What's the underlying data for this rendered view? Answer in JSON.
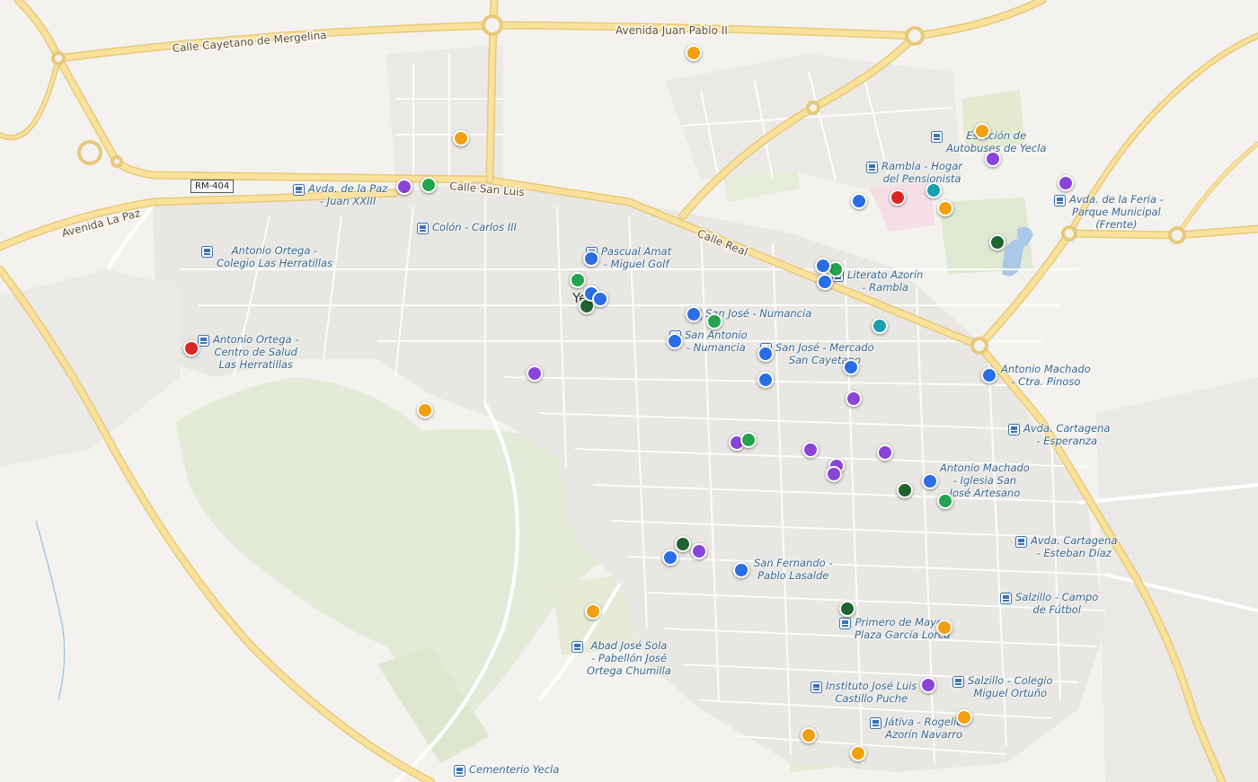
{
  "map": {
    "roads": [
      {
        "name": "Calle Cayetano de Mergelina"
      },
      {
        "name": "Avenida Juan Pablo II"
      },
      {
        "name": "Avenida La Paz"
      },
      {
        "name": "Calle San Luis"
      },
      {
        "name": "Calle Real"
      }
    ],
    "shield": "RM-404",
    "town": "Ye",
    "bus_stops": [
      {
        "label": "Avda. de la Paz\n- Juan XXIII"
      },
      {
        "label": "Colón - Carlos III"
      },
      {
        "label": "Antonio Ortega -\nColegio Las Herratillas"
      },
      {
        "label": "Antonio Ortega -\nCentro de Salud\nLas Herratillas"
      },
      {
        "label": "Pascual Amat\n- Miguel Golf"
      },
      {
        "label": "San José - Numancia"
      },
      {
        "label": "San Antonio\n- Numancia"
      },
      {
        "label": "San José - Mercado\nSan Cayetano"
      },
      {
        "label": "Literato Azorín\n- Rambla"
      },
      {
        "label": "Rambla - Hogar\ndel Pensionista"
      },
      {
        "label": "Estación de\nAutobuses de Yecla"
      },
      {
        "label": "Avda. de la Feria -\nParque Municipal\n(Frente)"
      },
      {
        "label": "Antonio Machado\n- Ctra. Pinoso"
      },
      {
        "label": "Avda. Cartagena\n- Esperanza"
      },
      {
        "label": "Antonio Machado\n- Iglesia San\nJosé Artesano"
      },
      {
        "label": "Avda. Cartagena\n- Esteban Díaz"
      },
      {
        "label": "Salzillo - Campo\nde Fútbol"
      },
      {
        "label": "San Fernando -\nPablo Lasalde"
      },
      {
        "label": "Primero de Mayo -\nPlaza García Lorca"
      },
      {
        "label": "Abad José Sola\n- Pabellón José\nOrtega Chumilla"
      },
      {
        "label": "Instituto José Luis\nCastillo Puche"
      },
      {
        "label": "Salzillo - Colegio\nMiguel Ortuño"
      },
      {
        "label": "Játiva - Rogelio\nAzorín Navarro"
      },
      {
        "label": "Cementerio Yecla"
      }
    ],
    "marker_colors": {
      "orange": "#f0a010",
      "purple": "#8a44d8",
      "green": "#24a44c",
      "dark-green": "#1e6330",
      "blue": "#2a6ee6",
      "red": "#dc2424",
      "teal": "#1aa0b0"
    },
    "markers": [
      {
        "color": "orange"
      },
      {
        "color": "orange"
      },
      {
        "color": "orange"
      },
      {
        "color": "orange"
      },
      {
        "color": "orange"
      },
      {
        "color": "orange"
      },
      {
        "color": "orange"
      },
      {
        "color": "orange"
      },
      {
        "color": "orange"
      },
      {
        "color": "orange"
      },
      {
        "color": "orange"
      },
      {
        "color": "purple"
      },
      {
        "color": "purple"
      },
      {
        "color": "purple"
      },
      {
        "color": "purple"
      },
      {
        "color": "purple"
      },
      {
        "color": "purple"
      },
      {
        "color": "purple"
      },
      {
        "color": "purple"
      },
      {
        "color": "purple"
      },
      {
        "color": "purple"
      },
      {
        "color": "purple"
      },
      {
        "color": "purple"
      },
      {
        "color": "green"
      },
      {
        "color": "green"
      },
      {
        "color": "green"
      },
      {
        "color": "green"
      },
      {
        "color": "green"
      },
      {
        "color": "green"
      },
      {
        "color": "dark-green"
      },
      {
        "color": "dark-green"
      },
      {
        "color": "dark-green"
      },
      {
        "color": "dark-green"
      },
      {
        "color": "dark-green"
      },
      {
        "color": "blue"
      },
      {
        "color": "blue"
      },
      {
        "color": "blue"
      },
      {
        "color": "blue"
      },
      {
        "color": "blue"
      },
      {
        "color": "blue"
      },
      {
        "color": "blue"
      },
      {
        "color": "blue"
      },
      {
        "color": "blue"
      },
      {
        "color": "blue"
      },
      {
        "color": "blue"
      },
      {
        "color": "blue"
      },
      {
        "color": "blue"
      },
      {
        "color": "blue"
      },
      {
        "color": "blue"
      },
      {
        "color": "red"
      },
      {
        "color": "red"
      },
      {
        "color": "teal"
      },
      {
        "color": "teal"
      }
    ]
  }
}
